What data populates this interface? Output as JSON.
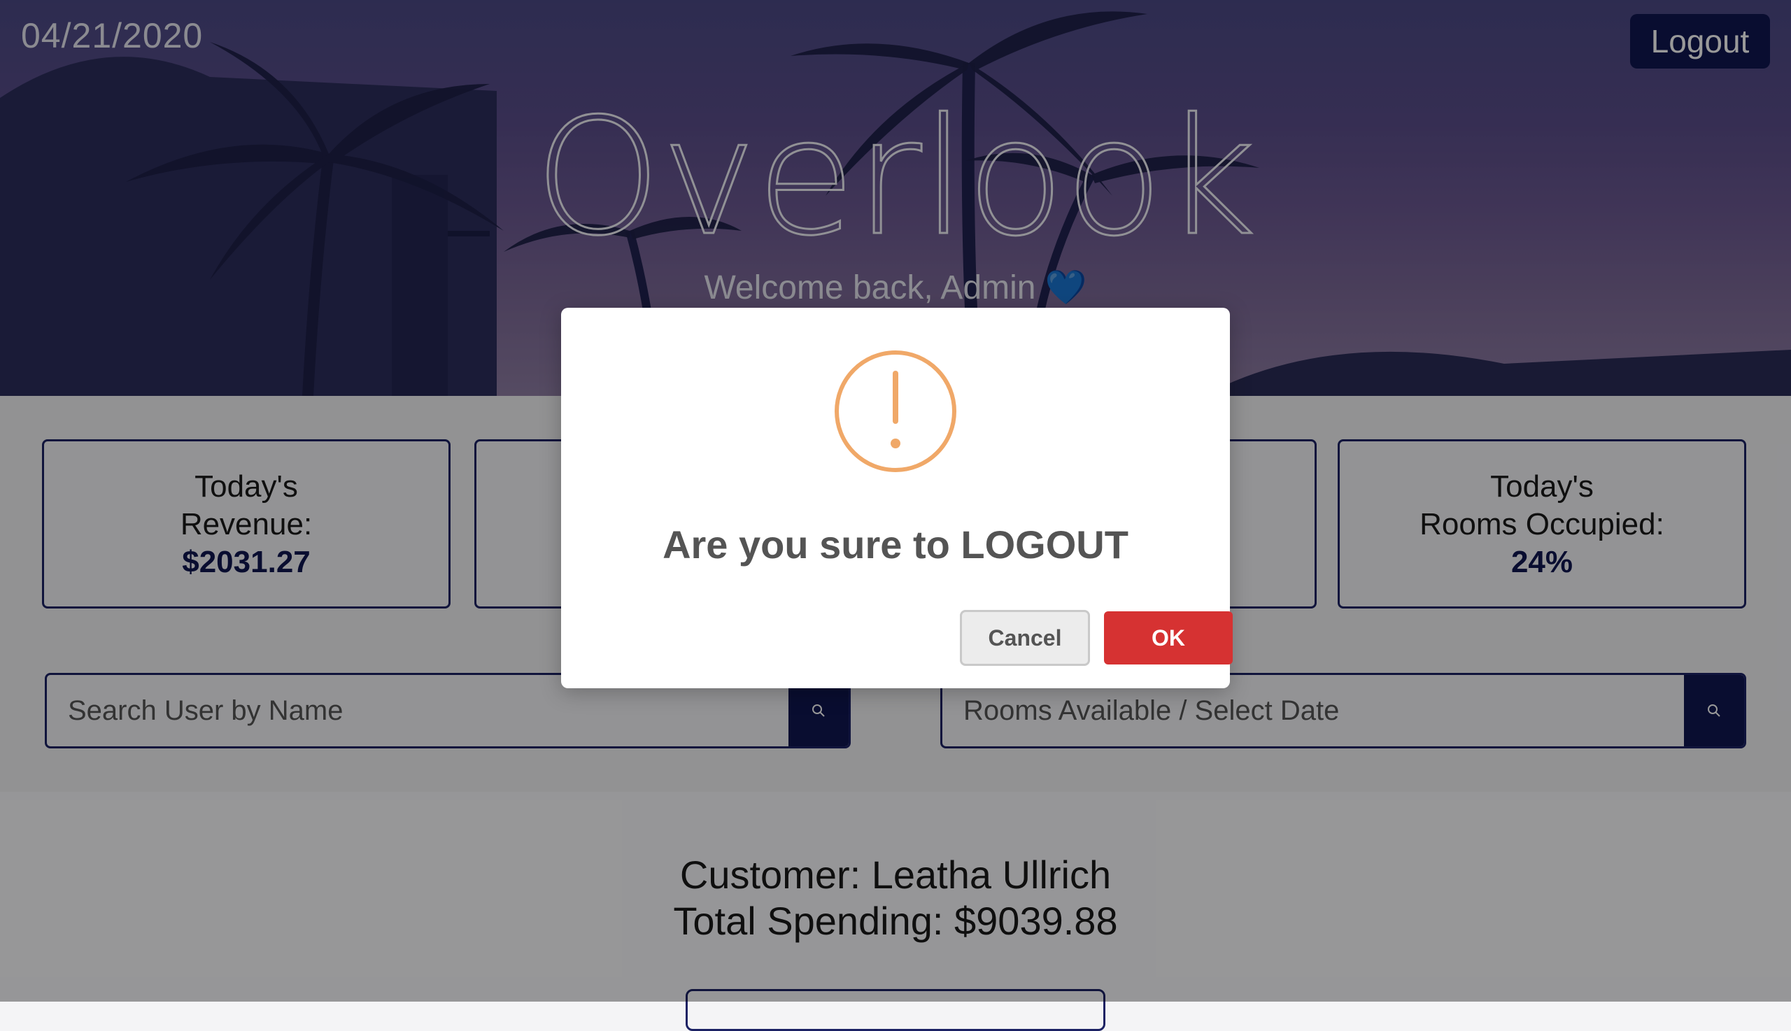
{
  "header": {
    "date": "04/21/2020",
    "logout_label": "Logout",
    "brand": "Overlook",
    "welcome": "Welcome back, Admin",
    "welcome_emoji": "💙"
  },
  "stats": [
    {
      "label_line1": "Today's",
      "label_line2": "Revenue:",
      "value": "$2031.27"
    },
    {
      "label_line1": "Today's",
      "label_line2": "Rooms Occupied:",
      "value": "24%"
    }
  ],
  "search": {
    "user_placeholder": "Search User by Name",
    "rooms_placeholder": "Rooms Available / Select Date",
    "icon": "search-icon"
  },
  "customer": {
    "name_line": "Customer: Leatha Ullrich",
    "spending_line": "Total Spending: $9039.88"
  },
  "modal": {
    "icon": "warning-icon",
    "title": "Are you sure to LOGOUT",
    "cancel_label": "Cancel",
    "ok_label": "OK",
    "accent_color": "#f0a868",
    "ok_color": "#d63232"
  },
  "colors": {
    "navy": "#101650"
  }
}
